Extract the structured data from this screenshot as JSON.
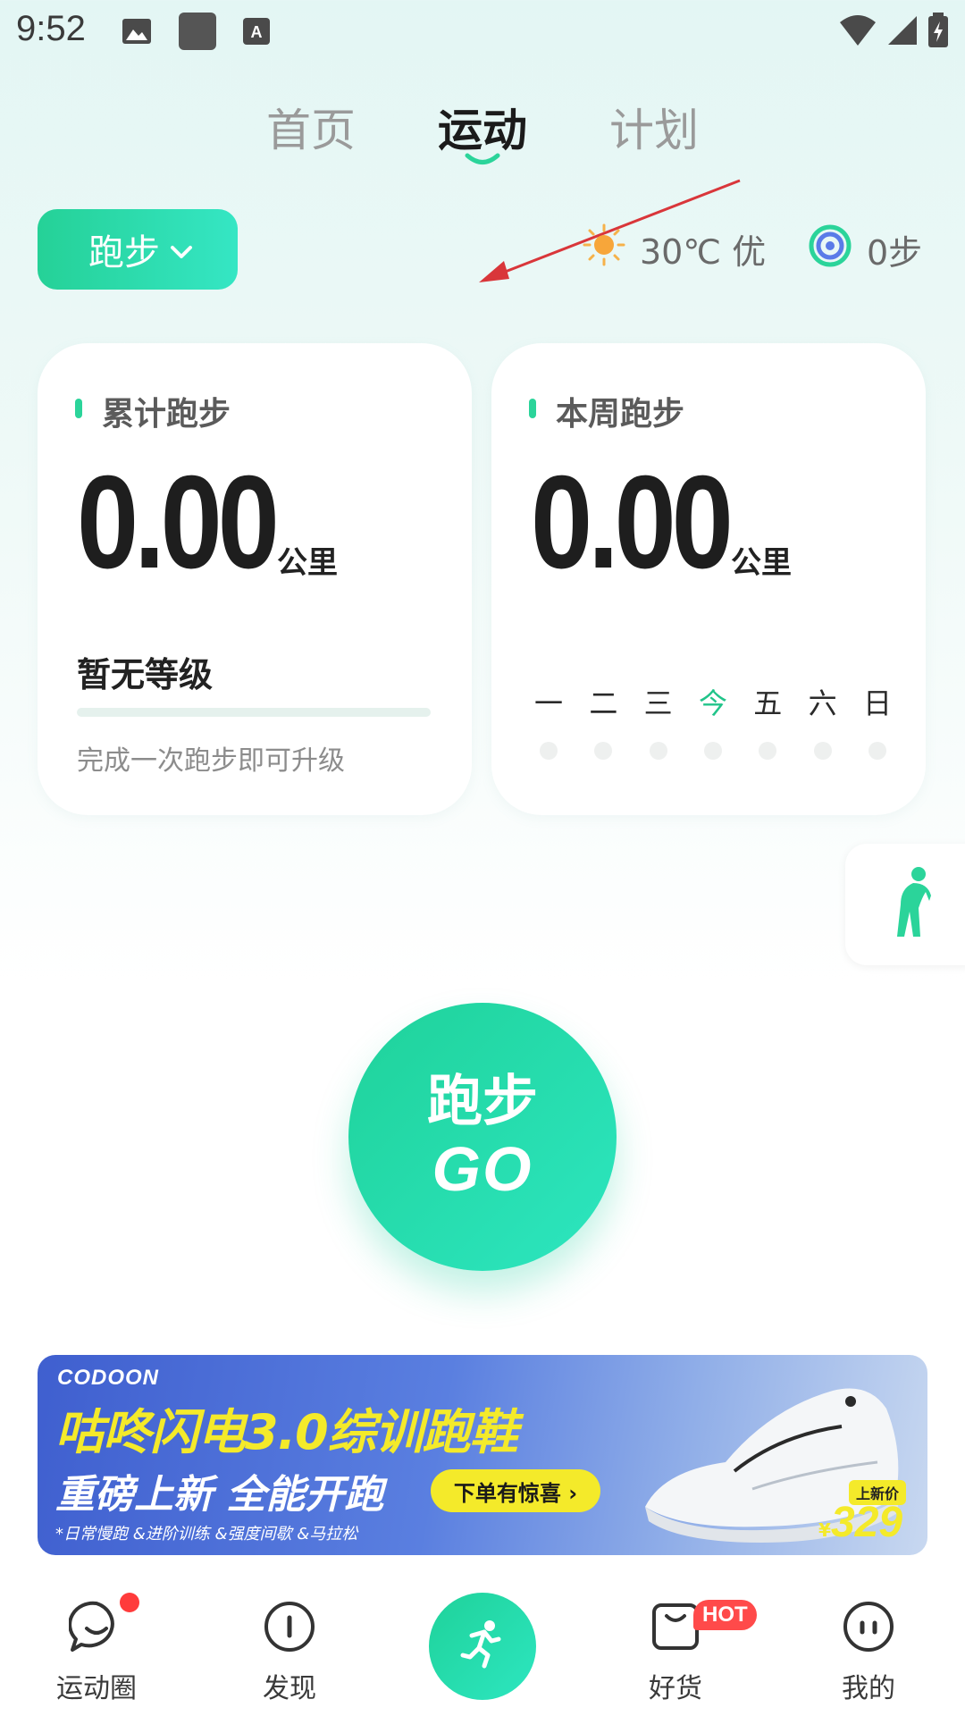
{
  "status_bar": {
    "time": "9:52"
  },
  "tabs": [
    {
      "label": "首页"
    },
    {
      "label": "运动"
    },
    {
      "label": "计划"
    }
  ],
  "sport_selector": {
    "label": "跑步"
  },
  "weather": {
    "text": "30℃ 优"
  },
  "steps": {
    "text": "0步"
  },
  "cumulative_card": {
    "title": "累计跑步",
    "value": "0.00",
    "unit": "公里",
    "level": "暂无等级",
    "progress": 0.0,
    "hint": "完成一次跑步即可升级"
  },
  "weekly_card": {
    "title": "本周跑步",
    "value": "0.00",
    "unit": "公里",
    "weekdays": [
      "一",
      "二",
      "三",
      "今",
      "五",
      "六",
      "日"
    ],
    "today_index": 3
  },
  "go_button": {
    "line1": "跑步",
    "line2": "GO"
  },
  "banner": {
    "brand": "CODOON",
    "title": "咕咚闪电3.0综训跑鞋",
    "subtitle": "重磅上新 全能开跑",
    "cta": "下单有惊喜 ›",
    "tags": "*日常慢跑 &进阶训练 &强度间歇 &马拉松",
    "new_price_label": "上新价",
    "currency": "¥",
    "price": "329"
  },
  "bottom_nav": {
    "items": [
      {
        "label": "运动圈"
      },
      {
        "label": "发现"
      },
      {
        "label": "好货"
      },
      {
        "label": "我的"
      }
    ],
    "hot_badge": "HOT"
  },
  "colors": {
    "accent": "#2bd49a",
    "accent_light": "#35e6c4",
    "banner_yellow": "#f4ea2a",
    "badge_red": "#ff4a4a"
  }
}
